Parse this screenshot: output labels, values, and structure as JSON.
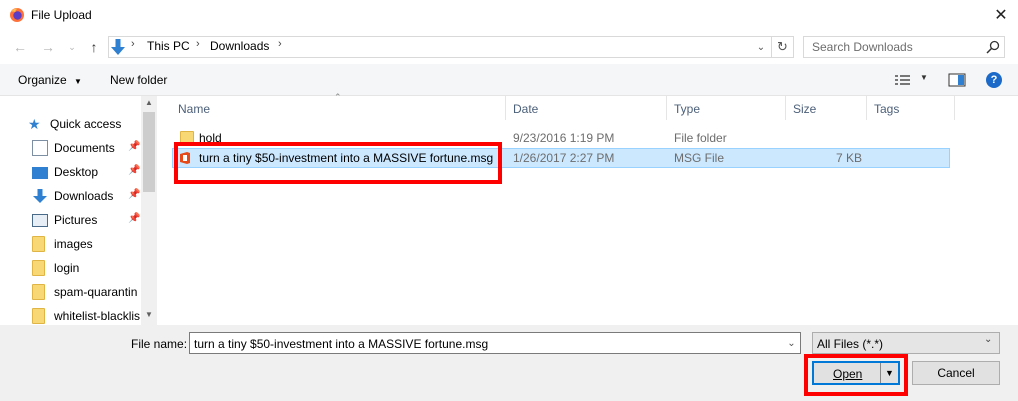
{
  "window": {
    "title": "File Upload"
  },
  "nav": {
    "breadcrumbs": [
      "This PC",
      "Downloads"
    ],
    "search_placeholder": "Search Downloads"
  },
  "toolbar": {
    "organize_label": "Organize",
    "new_folder_label": "New folder",
    "help_label": "?"
  },
  "sidebar": {
    "items": [
      {
        "label": "Quick access",
        "icon": "star-icon"
      },
      {
        "label": "Documents",
        "icon": "documents-icon",
        "pinned": true
      },
      {
        "label": "Desktop",
        "icon": "desktop-icon",
        "pinned": true
      },
      {
        "label": "Downloads",
        "icon": "download-arrow-icon",
        "pinned": true
      },
      {
        "label": "Pictures",
        "icon": "pictures-icon",
        "pinned": true
      },
      {
        "label": "images",
        "icon": "folder-icon"
      },
      {
        "label": "login",
        "icon": "folder-icon"
      },
      {
        "label": "spam-quarantin",
        "icon": "folder-icon"
      },
      {
        "label": "whitelist-blacklis",
        "icon": "folder-icon"
      }
    ]
  },
  "file_list": {
    "columns": [
      "Name",
      "Date",
      "Type",
      "Size",
      "Tags"
    ],
    "rows": [
      {
        "name": "hold",
        "date": "9/23/2016 1:19 PM",
        "type": "File folder",
        "size": "",
        "icon": "folder-icon"
      },
      {
        "name": "turn a tiny $50-investment into a MASSIVE fortune.msg",
        "date": "1/26/2017 2:27 PM",
        "type": "MSG File",
        "size": "7 KB",
        "icon": "office-icon",
        "selected": true
      }
    ]
  },
  "bottom": {
    "file_name_label": "File name:",
    "file_name_value": "turn a tiny $50-investment into a MASSIVE fortune.msg",
    "filter_value": "All Files (*.*)",
    "open_label": "Open",
    "cancel_label": "Cancel"
  },
  "colors": {
    "selection_bg": "#cce8ff",
    "highlight_box": "#ff0000",
    "accent": "#0078d7"
  }
}
